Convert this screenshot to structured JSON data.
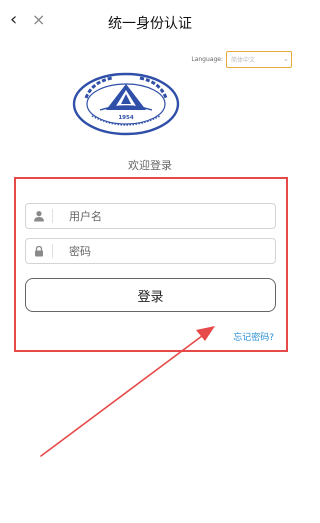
{
  "nav": {
    "title": "统一身份认证",
    "back_icon": "‹",
    "close_icon": "×"
  },
  "language": {
    "label": "Language:",
    "selected": "简体中文"
  },
  "logo": {
    "year": "1954"
  },
  "login": {
    "welcome": "欢迎登录",
    "username_placeholder": "用户名",
    "password_placeholder": "密码",
    "submit_label": "登录",
    "forgot_label": "忘记密码?"
  },
  "colors": {
    "annotation_red": "#e64a48",
    "link_blue": "#2a8fd6",
    "lang_border": "#e9a93a",
    "logo_blue": "#2f4fa8"
  }
}
